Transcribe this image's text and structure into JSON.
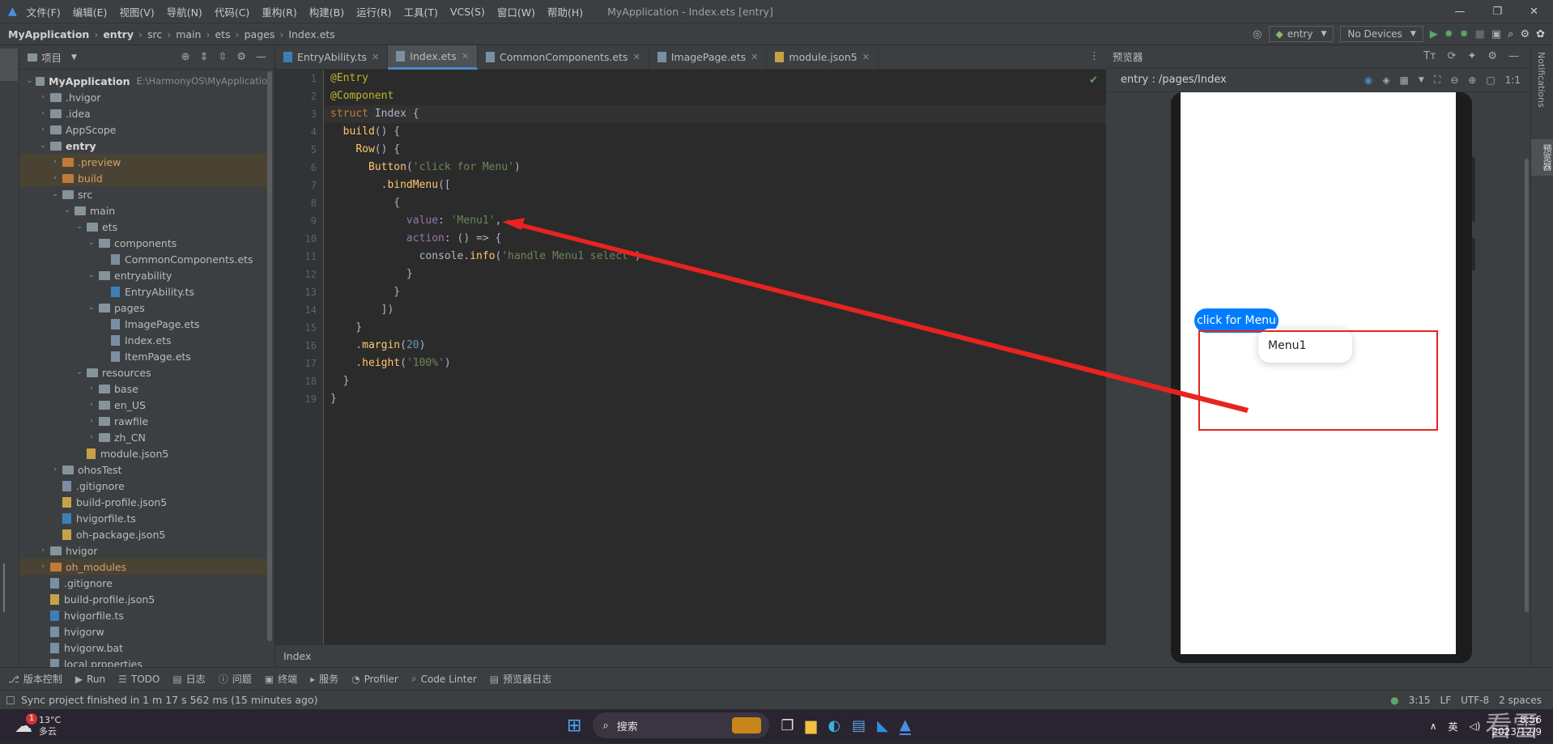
{
  "titlebar": {
    "menu": [
      "文件(F)",
      "编辑(E)",
      "视图(V)",
      "导航(N)",
      "代码(C)",
      "重构(R)",
      "构建(B)",
      "运行(R)",
      "工具(T)",
      "VCS(S)",
      "窗口(W)",
      "帮助(H)"
    ],
    "title": "MyApplication - Index.ets [entry]"
  },
  "navbar": {
    "crumbs": [
      "MyApplication",
      "entry",
      "src",
      "main",
      "ets",
      "pages",
      "Index.ets"
    ],
    "config": "entry",
    "devices": "No Devices"
  },
  "project": {
    "header": "项目",
    "tree": [
      {
        "d": 0,
        "t": "MyApplication",
        "ex": "E:\\HarmonyOS\\MyApplicatio",
        "k": "folder",
        "o": 1,
        "b": 1
      },
      {
        "d": 1,
        "t": ".hvigor",
        "k": "folder"
      },
      {
        "d": 1,
        "t": ".idea",
        "k": "folder"
      },
      {
        "d": 1,
        "t": "AppScope",
        "k": "folder"
      },
      {
        "d": 1,
        "t": "entry",
        "k": "folder",
        "o": 1,
        "b": 1
      },
      {
        "d": 2,
        "t": ".preview",
        "k": "ofolder",
        "h": 1
      },
      {
        "d": 2,
        "t": "build",
        "k": "ofolder",
        "h": 1
      },
      {
        "d": 2,
        "t": "src",
        "k": "folder",
        "o": 1
      },
      {
        "d": 3,
        "t": "main",
        "k": "folder",
        "o": 1
      },
      {
        "d": 4,
        "t": "ets",
        "k": "folder",
        "o": 1
      },
      {
        "d": 5,
        "t": "components",
        "k": "folder",
        "o": 1
      },
      {
        "d": 6,
        "t": "CommonComponents.ets",
        "k": "file",
        "n": 1
      },
      {
        "d": 5,
        "t": "entryability",
        "k": "folder",
        "o": 1
      },
      {
        "d": 6,
        "t": "EntryAbility.ts",
        "k": "ts",
        "n": 1
      },
      {
        "d": 5,
        "t": "pages",
        "k": "folder",
        "o": 1
      },
      {
        "d": 6,
        "t": "ImagePage.ets",
        "k": "file",
        "n": 1
      },
      {
        "d": 6,
        "t": "Index.ets",
        "k": "file",
        "n": 1
      },
      {
        "d": 6,
        "t": "ItemPage.ets",
        "k": "file",
        "n": 1
      },
      {
        "d": 4,
        "t": "resources",
        "k": "folder",
        "o": 1
      },
      {
        "d": 5,
        "t": "base",
        "k": "folder"
      },
      {
        "d": 5,
        "t": "en_US",
        "k": "folder"
      },
      {
        "d": 5,
        "t": "rawfile",
        "k": "folder"
      },
      {
        "d": 5,
        "t": "zh_CN",
        "k": "folder"
      },
      {
        "d": 4,
        "t": "module.json5",
        "k": "json",
        "n": 1
      },
      {
        "d": 2,
        "t": "ohosTest",
        "k": "folder"
      },
      {
        "d": 2,
        "t": ".gitignore",
        "k": "file",
        "n": 1
      },
      {
        "d": 2,
        "t": "build-profile.json5",
        "k": "json",
        "n": 1
      },
      {
        "d": 2,
        "t": "hvigorfile.ts",
        "k": "ts",
        "n": 1
      },
      {
        "d": 2,
        "t": "oh-package.json5",
        "k": "json",
        "n": 1
      },
      {
        "d": 1,
        "t": "hvigor",
        "k": "folder"
      },
      {
        "d": 1,
        "t": "oh_modules",
        "k": "ofolder",
        "h": 1
      },
      {
        "d": 1,
        "t": ".gitignore",
        "k": "file",
        "n": 1
      },
      {
        "d": 1,
        "t": "build-profile.json5",
        "k": "json",
        "n": 1
      },
      {
        "d": 1,
        "t": "hvigorfile.ts",
        "k": "ts",
        "n": 1
      },
      {
        "d": 1,
        "t": "hvigorw",
        "k": "file",
        "n": 1
      },
      {
        "d": 1,
        "t": "hvigorw.bat",
        "k": "file",
        "n": 1
      },
      {
        "d": 1,
        "t": "local.properties",
        "k": "file",
        "n": 1
      }
    ]
  },
  "tabs": [
    {
      "label": "EntryAbility.ts"
    },
    {
      "label": "Index.ets",
      "active": true
    },
    {
      "label": "CommonComponents.ets"
    },
    {
      "label": "ImagePage.ets"
    },
    {
      "label": "module.json5"
    }
  ],
  "code": [
    [
      [
        "an",
        "@Entry"
      ]
    ],
    [
      [
        "an",
        "@Component"
      ]
    ],
    [
      [
        "kw",
        "struct "
      ],
      [
        "pu",
        "Index {"
      ]
    ],
    [
      [
        "pu",
        "  "
      ],
      [
        "fn",
        "build"
      ],
      [
        "pu",
        "() {"
      ]
    ],
    [
      [
        "pu",
        "    "
      ],
      [
        "fn",
        "Row"
      ],
      [
        "pu",
        "() {"
      ]
    ],
    [
      [
        "pu",
        "      "
      ],
      [
        "fn",
        "Button"
      ],
      [
        "pu",
        "("
      ],
      [
        "st",
        "'click for Menu'"
      ],
      [
        "pu",
        ")"
      ]
    ],
    [
      [
        "pu",
        "        ."
      ],
      [
        "fd",
        "bindMenu"
      ],
      [
        "pu",
        "(["
      ]
    ],
    [
      [
        "pu",
        "          {"
      ]
    ],
    [
      [
        "pu",
        "            "
      ],
      [
        "pr",
        "value"
      ],
      [
        "pu",
        ": "
      ],
      [
        "st",
        "'Menu1'"
      ],
      [
        "pu",
        ","
      ]
    ],
    [
      [
        "pu",
        "            "
      ],
      [
        "pr",
        "action"
      ],
      [
        "pu",
        ": () => {"
      ]
    ],
    [
      [
        "pu",
        "              console."
      ],
      [
        "fd",
        "info"
      ],
      [
        "pu",
        "("
      ],
      [
        "st",
        "'handle Menu1 select'"
      ],
      [
        "pu",
        ")"
      ]
    ],
    [
      [
        "pu",
        "            }"
      ]
    ],
    [
      [
        "pu",
        "          }"
      ]
    ],
    [
      [
        "pu",
        "        ])"
      ]
    ],
    [
      [
        "pu",
        "    }"
      ]
    ],
    [
      [
        "pu",
        "    ."
      ],
      [
        "fd",
        "margin"
      ],
      [
        "pu",
        "("
      ],
      [
        "nm",
        "20"
      ],
      [
        "pu",
        ")"
      ]
    ],
    [
      [
        "pu",
        "    ."
      ],
      [
        "fd",
        "height"
      ],
      [
        "pu",
        "("
      ],
      [
        "st",
        "'100%'"
      ],
      [
        "pu",
        ")"
      ]
    ],
    [
      [
        "pu",
        "  }"
      ]
    ],
    [
      [
        "pu",
        "}"
      ]
    ]
  ],
  "editor_footer": "Index",
  "preview": {
    "header": "预览器",
    "path": "entry : /pages/Index",
    "button_label": "click for Menu",
    "menu_item": "Menu1"
  },
  "rightstrip": [
    "Notifications",
    "预览器"
  ],
  "toolwindows": [
    "版本控制",
    "Run",
    "TODO",
    "日志",
    "问题",
    "终端",
    "服务",
    "Profiler",
    "Code Linter",
    "预览器日志"
  ],
  "status": {
    "message": "Sync project finished in 1 m 17 s 562 ms (15 minutes ago)",
    "pos": "3:15",
    "encoding": "UTF-8",
    "spaces": "2 spaces"
  },
  "taskbar": {
    "temp": "13°C",
    "weather": "多云",
    "badge": "1",
    "search": "搜索",
    "ime": "英",
    "time": "8:56",
    "date": "2023/12/9"
  },
  "watermark": "看雪",
  "colors": {
    "accent": "#007dff",
    "highlight_box": "#e8231f"
  }
}
